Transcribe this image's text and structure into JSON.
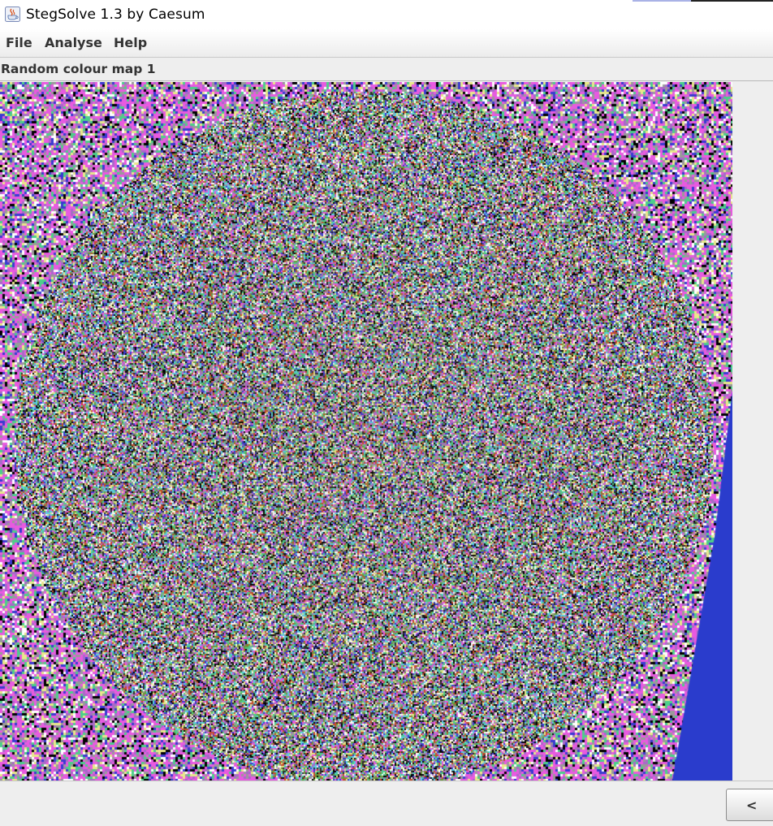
{
  "window": {
    "title": "StegSolve 1.3 by Caesum",
    "icon": "java-cup-icon"
  },
  "menu": {
    "items": [
      "File",
      "Analyse",
      "Help"
    ]
  },
  "view": {
    "label": "Random colour map 1",
    "image": "random-colour-map-noise-image"
  },
  "nav": {
    "prev_label": "<"
  },
  "colors": {
    "noise_palette": [
      "#e85ae0",
      "#3a3ad0",
      "#4ccf8a",
      "#e8e88a",
      "#9a9a9a",
      "#ffffff",
      "#000000",
      "#6a9a3a",
      "#c84a2a",
      "#5ad0e8",
      "#a86ac8",
      "#2a2a2a"
    ],
    "side_blue": "#2a3ccc",
    "corner_magenta": "#e85ae0"
  }
}
